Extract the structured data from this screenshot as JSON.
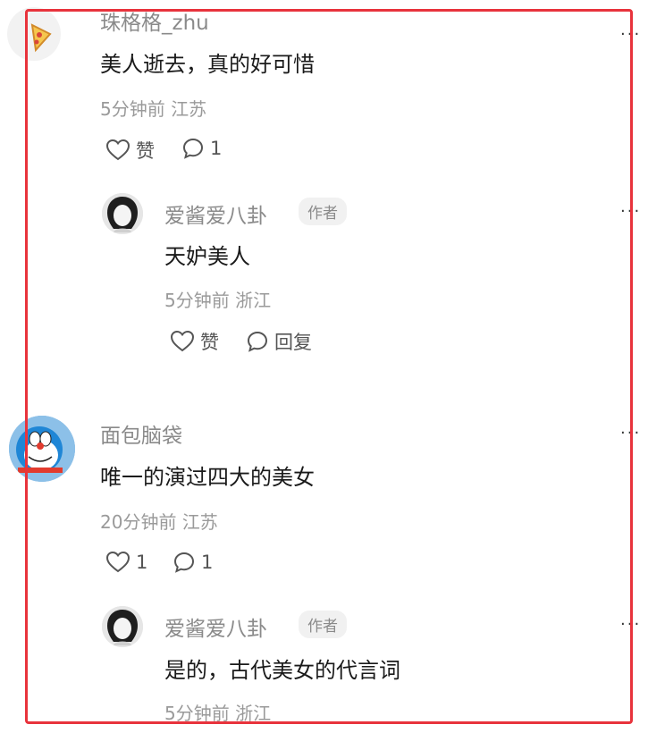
{
  "comments": [
    {
      "username": "珠格格_zhu",
      "text": "美人逝去，真的好可惜",
      "meta": "5分钟前 江苏",
      "like_label": "赞",
      "reply_count": "1",
      "replies": [
        {
          "username": "爱酱爱八卦",
          "badge": "作者",
          "text": "天妒美人",
          "meta": "5分钟前 浙江",
          "like_label": "赞",
          "reply_label": "回复"
        }
      ]
    },
    {
      "username": "面包脑袋",
      "text": "唯一的演过四大的美女",
      "meta": "20分钟前 江苏",
      "like_count": "1",
      "reply_count": "1",
      "replies": [
        {
          "username": "爱酱爱八卦",
          "badge": "作者",
          "text": "是的，古代美女的代言词",
          "meta": "5分钟前 浙江"
        }
      ]
    }
  ],
  "more_glyph": "···",
  "colors": {
    "highlight_border": "#e8333c",
    "meta_text": "#9a9a9a"
  }
}
